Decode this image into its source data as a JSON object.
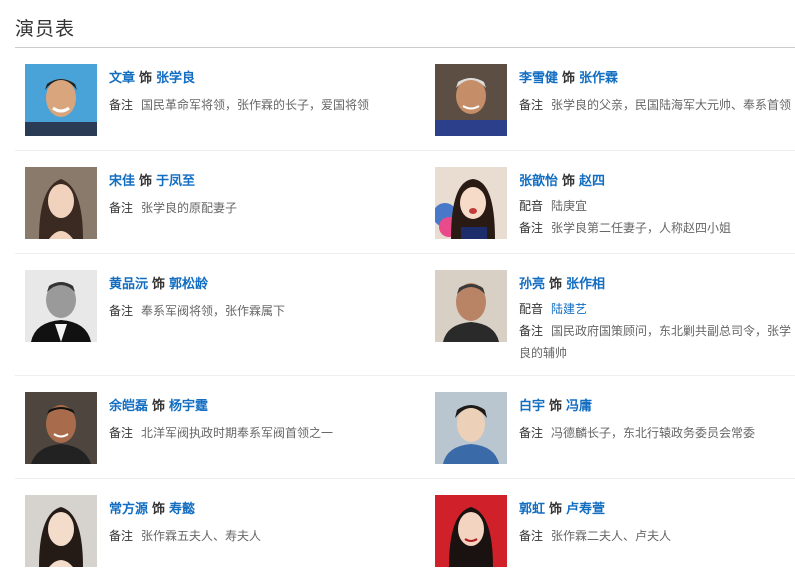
{
  "section": {
    "title": "演员表"
  },
  "labels": {
    "shi": "饰",
    "note": "备注",
    "voice": "配音"
  },
  "cast": [
    {
      "actor": "文章",
      "role": "张学良",
      "note": "国民革命军将领，张作霖的长子，爱国将领",
      "photo_bg": "#4aa3d8"
    },
    {
      "actor": "李雪健",
      "role": "张作霖",
      "note": "张学良的父亲，民国陆海军大元帅、奉系首领",
      "photo_bg": "#6b5a4a"
    },
    {
      "actor": "宋佳",
      "role": "于凤至",
      "note": "张学良的原配妻子",
      "photo_bg": "#7a6b60"
    },
    {
      "actor": "张歆怡",
      "role": "赵四",
      "voice": "陆庚宜",
      "note": "张学良第二任妻子，人称赵四小姐",
      "photo_bg": "#e8dcd0"
    },
    {
      "actor": "黄品沅",
      "role": "郭松龄",
      "note": "奉系军阀将领，张作霖属下",
      "photo_bg": "#e6e6e6"
    },
    {
      "actor": "孙亮",
      "role": "张作相",
      "voice": "陆建艺",
      "note": "国民政府国策顾问，东北剿共副总司令，张学良的辅帅",
      "photo_bg": "#d8d0c4"
    },
    {
      "actor": "余皑磊",
      "role": "杨宇霆",
      "note": "北洋军阀执政时期奉系军阀首领之一",
      "photo_bg": "#5a5048"
    },
    {
      "actor": "白宇",
      "role": "冯庸",
      "note": "冯德麟长子，东北行辕政务委员会常委",
      "photo_bg": "#b8c4cc"
    },
    {
      "actor": "常方源",
      "role": "寿懿",
      "note": "张作霖五夫人、寿夫人",
      "photo_bg": "#d4d0cc"
    },
    {
      "actor": "郭虹",
      "role": "卢寿萱",
      "note": "张作霖二夫人、卢夫人",
      "photo_bg": "#d0202a"
    }
  ]
}
